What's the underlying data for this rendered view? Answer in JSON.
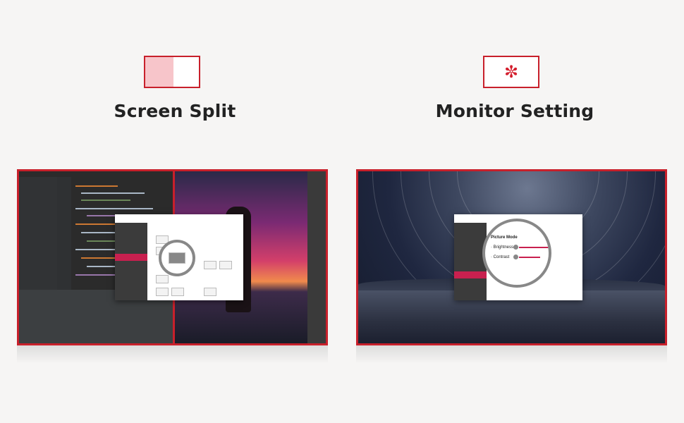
{
  "features": [
    {
      "title": "Screen Split",
      "icon": "screen-split-icon"
    },
    {
      "title": "Monitor Setting",
      "icon": "gear-icon",
      "icon_glyph": "✼"
    }
  ],
  "magnifier": {
    "heading": "Picture Mode",
    "brightness": "· Brightness",
    "contrast": "· Contrast"
  },
  "colors": {
    "accent": "#c8202b",
    "nav_active": "#c8204f",
    "background": "#f6f5f4"
  }
}
